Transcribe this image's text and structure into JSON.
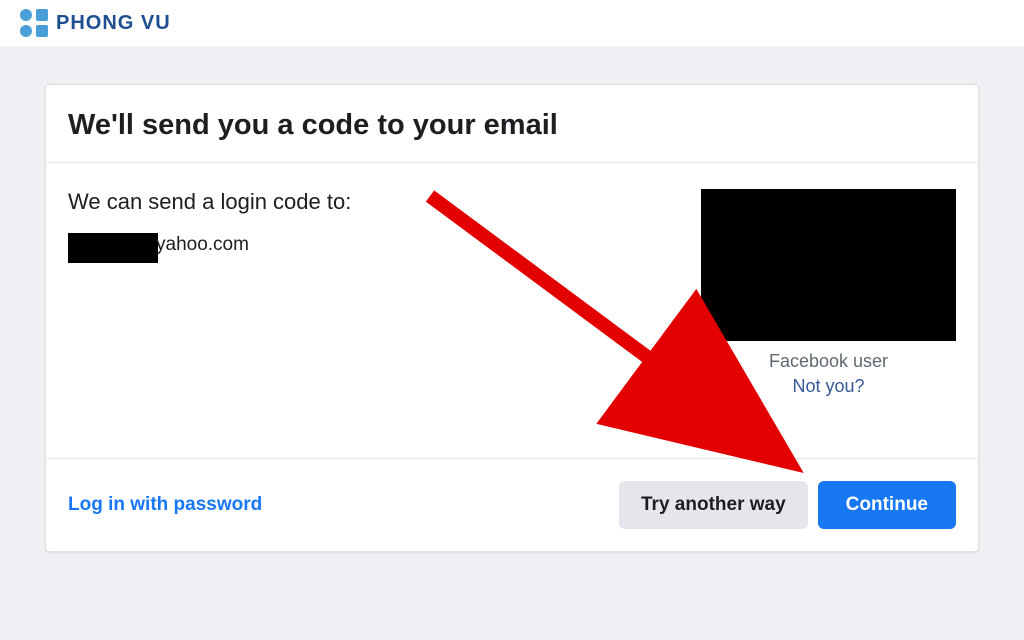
{
  "brand": {
    "name": "PHONG VU"
  },
  "card": {
    "title": "We'll send you a code to your email",
    "intro": "We can send a login code to:",
    "email_visible_part": "yahoo.com",
    "user_label": "Facebook user",
    "not_you_label": "Not you?"
  },
  "footer": {
    "login_password": "Log in with password",
    "try_another": "Try another way",
    "continue": "Continue"
  }
}
